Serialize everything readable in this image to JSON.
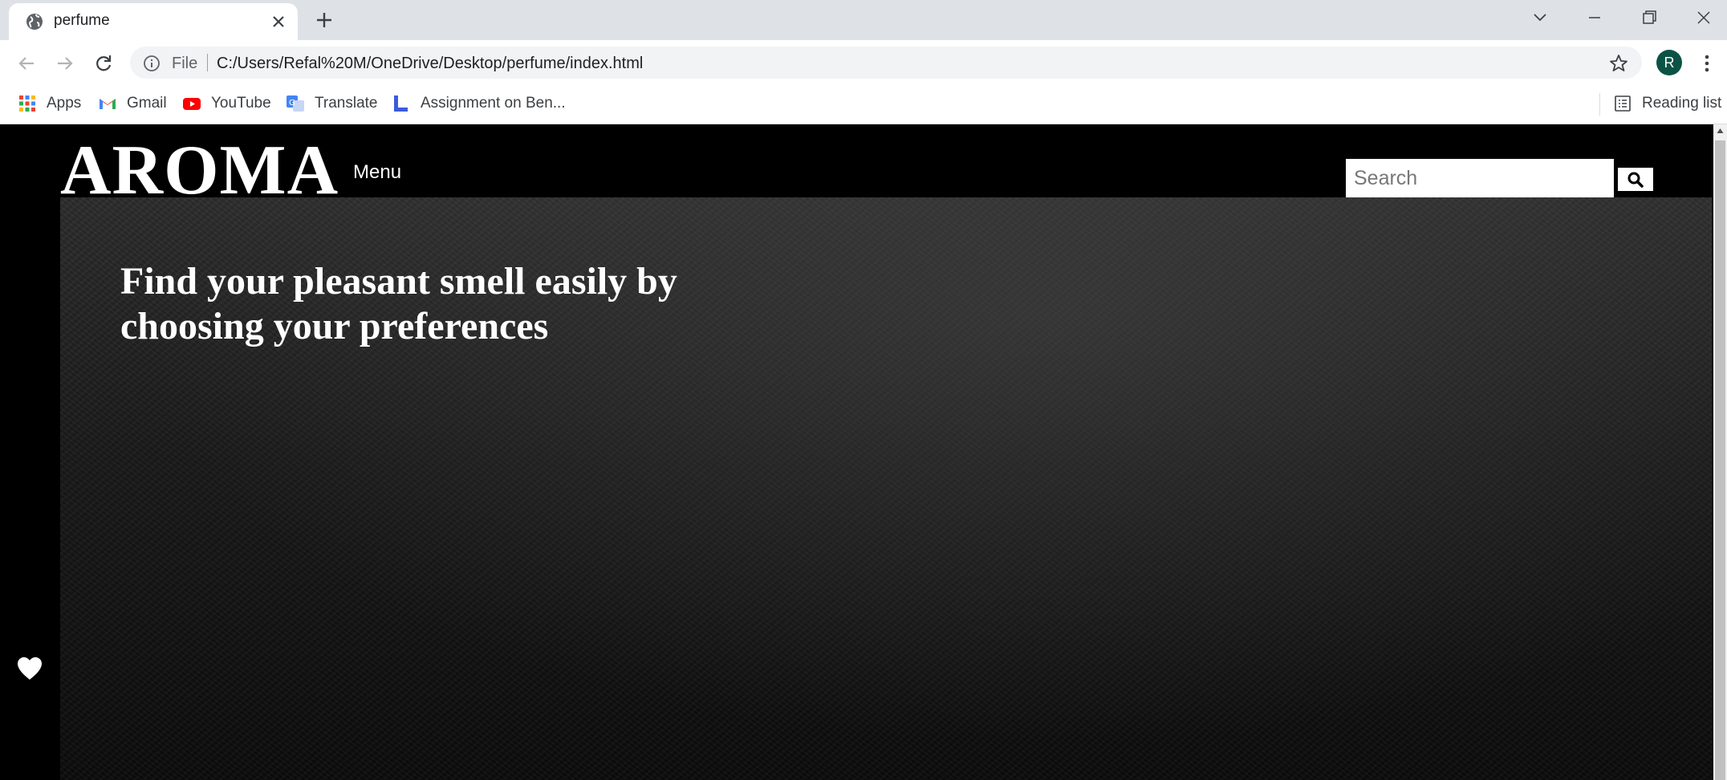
{
  "browser": {
    "tab": {
      "title": "perfume"
    },
    "address": {
      "scheme_label": "File",
      "url": "C:/Users/Refal%20M/OneDrive/Desktop/perfume/index.html"
    },
    "profile_initial": "R",
    "bookmarks": [
      {
        "label": "Apps",
        "icon": "apps-grid-icon"
      },
      {
        "label": "Gmail",
        "icon": "gmail-icon"
      },
      {
        "label": "YouTube",
        "icon": "youtube-icon"
      },
      {
        "label": "Translate",
        "icon": "translate-icon"
      },
      {
        "label": "Assignment on Ben...",
        "icon": "assignment-icon"
      }
    ],
    "reading_list_label": "Reading list"
  },
  "page": {
    "logo": "AROMA",
    "menu_label": "Menu",
    "search_placeholder": "Search",
    "headline": "Find your pleasant smell easily by choosing your preferences"
  },
  "colors": {
    "page_background": "#000000",
    "text": "#ffffff",
    "tabstrip": "#dee1e6",
    "avatar": "#0b5345"
  }
}
